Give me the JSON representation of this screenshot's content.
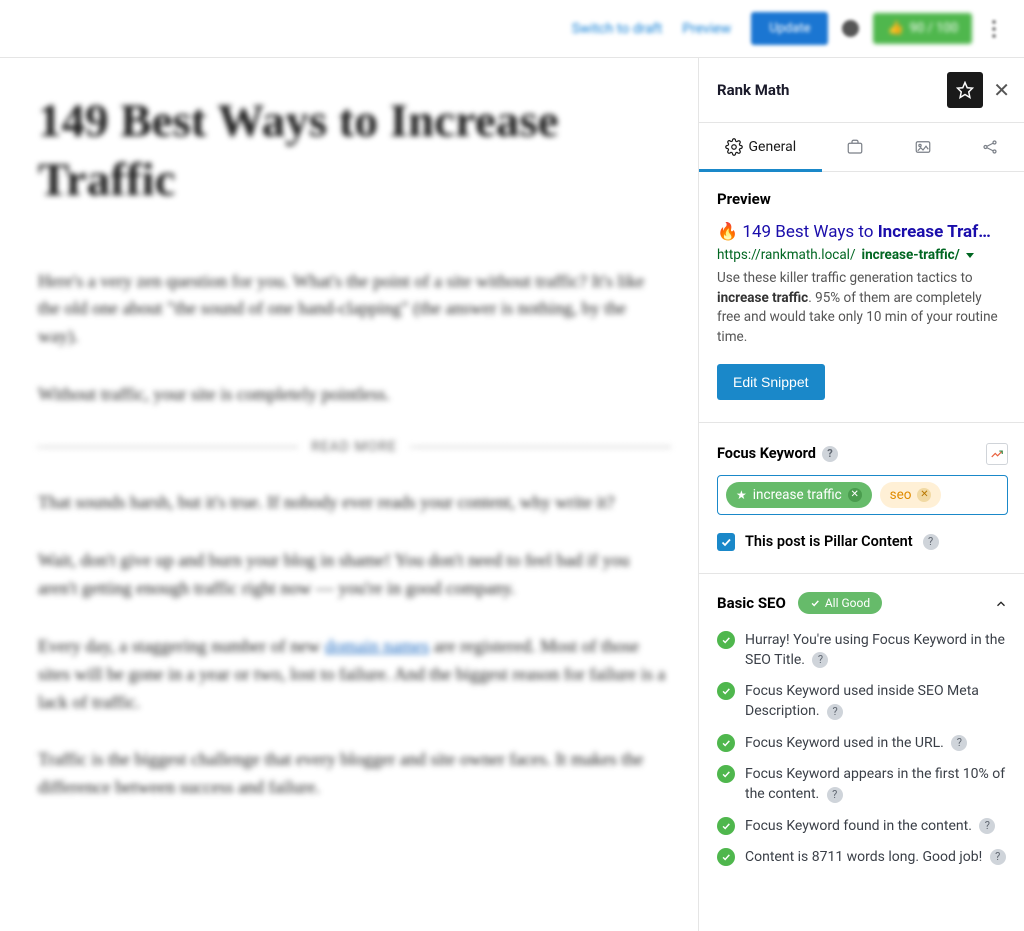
{
  "topbar": {
    "switch_to_draft": "Switch to draft",
    "preview": "Preview",
    "update": "Update",
    "score": "90 / 100"
  },
  "editor": {
    "title": "149 Best Ways to Increase Traffic",
    "p1": "Here's a very zen question for you. What's the point of a site without traffic? It's like the old one about \"the sound of one hand-clapping\" (the answer is nothing, by the way).",
    "p2": "Without traffic, your site is completely pointless.",
    "readmore": "READ MORE",
    "p3": "That sounds harsh, but it's true. If nobody ever reads your content, why write it?",
    "p4_pre": "Wait, don't give up and burn your blog in shame! You don't need to feel bad if you aren't getting enough traffic right now — you're in good company.",
    "p5_a": "Every day, a staggering number of new ",
    "p5_link": "domain names",
    "p5_b": " are registered. Most of those sites will be gone in a year or two, lost to failure. And the biggest reason for failure is a lack of traffic.",
    "p6": "Traffic is the biggest challenge that every blogger and site owner faces. It makes the difference between success and failure."
  },
  "sidebar": {
    "title": "Rank Math",
    "tabs": {
      "general": "General"
    },
    "preview": {
      "heading": "Preview",
      "emoji": "🔥",
      "title_a": "149 Best Ways to ",
      "title_b": "Increase Traf",
      "title_c": "…",
      "url_a": "https://rankmath.local/",
      "url_b": "increase-traffic/",
      "desc_a": "Use these killer traffic generation tactics to ",
      "desc_b": "increase traffic",
      "desc_c": ". 95% of them are completely free and would take only 10 min of your routine time.",
      "edit_snippet": "Edit Snippet"
    },
    "focus_keyword": {
      "label": "Focus Keyword",
      "tags": {
        "primary": "increase traffic",
        "secondary": "seo"
      }
    },
    "pillar": {
      "label": "This post is Pillar Content"
    },
    "basic_seo": {
      "title": "Basic SEO",
      "all_good": "All Good",
      "items": {
        "i0": "Hurray! You're using Focus Keyword in the SEO Title.",
        "i1": "Focus Keyword used inside SEO Meta Description.",
        "i2": "Focus Keyword used in the URL.",
        "i3": "Focus Keyword appears in the first 10% of the content.",
        "i4": "Focus Keyword found in the content.",
        "i5": "Content is 8711 words long. Good job!"
      }
    }
  }
}
